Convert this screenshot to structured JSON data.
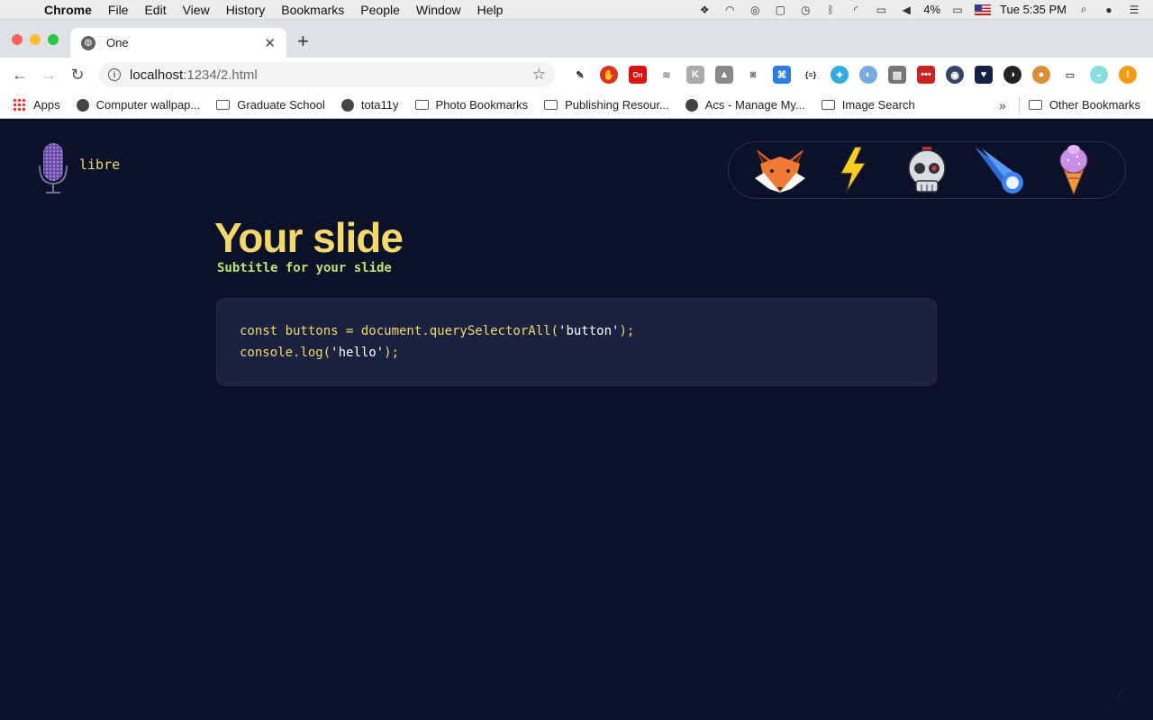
{
  "menubar": {
    "app_name": "Chrome",
    "items": [
      "File",
      "Edit",
      "View",
      "History",
      "Bookmarks",
      "People",
      "Window",
      "Help"
    ],
    "battery": "4%",
    "clock": "Tue 5:35 PM"
  },
  "browser": {
    "tab_title": "One",
    "url_host": "localhost",
    "url_path": ":1234/2.html",
    "bookmarks": [
      {
        "label": "Apps",
        "icon": "apps-grid-icon"
      },
      {
        "label": "Computer wallpap...",
        "icon": "globe-icon"
      },
      {
        "label": "Graduate School",
        "icon": "folder-icon"
      },
      {
        "label": "tota11y",
        "icon": "globe-icon"
      },
      {
        "label": "Photo Bookmarks",
        "icon": "folder-icon"
      },
      {
        "label": "Publishing Resour...",
        "icon": "folder-icon"
      },
      {
        "label": "Acs - Manage My...",
        "icon": "globe-icon"
      },
      {
        "label": "Image Search",
        "icon": "folder-icon"
      }
    ],
    "other_bookmarks": "Other Bookmarks",
    "extension_badge": "On"
  },
  "slide": {
    "logo_text": "libre",
    "title": "Your slide",
    "subtitle": "Subtitle for your slide",
    "code_lines": [
      "const buttons = document.querySelectorAll('button');",
      "console.log('hello');"
    ],
    "emoji_buttons": [
      "fox-icon",
      "lightning-icon",
      "skull-icon",
      "comet-icon",
      "ice-cream-icon"
    ]
  },
  "colors": {
    "background": "#0b1128",
    "title": "#f5d86b",
    "subtitle": "#b8e86b",
    "code_bg": "#1a2240"
  }
}
